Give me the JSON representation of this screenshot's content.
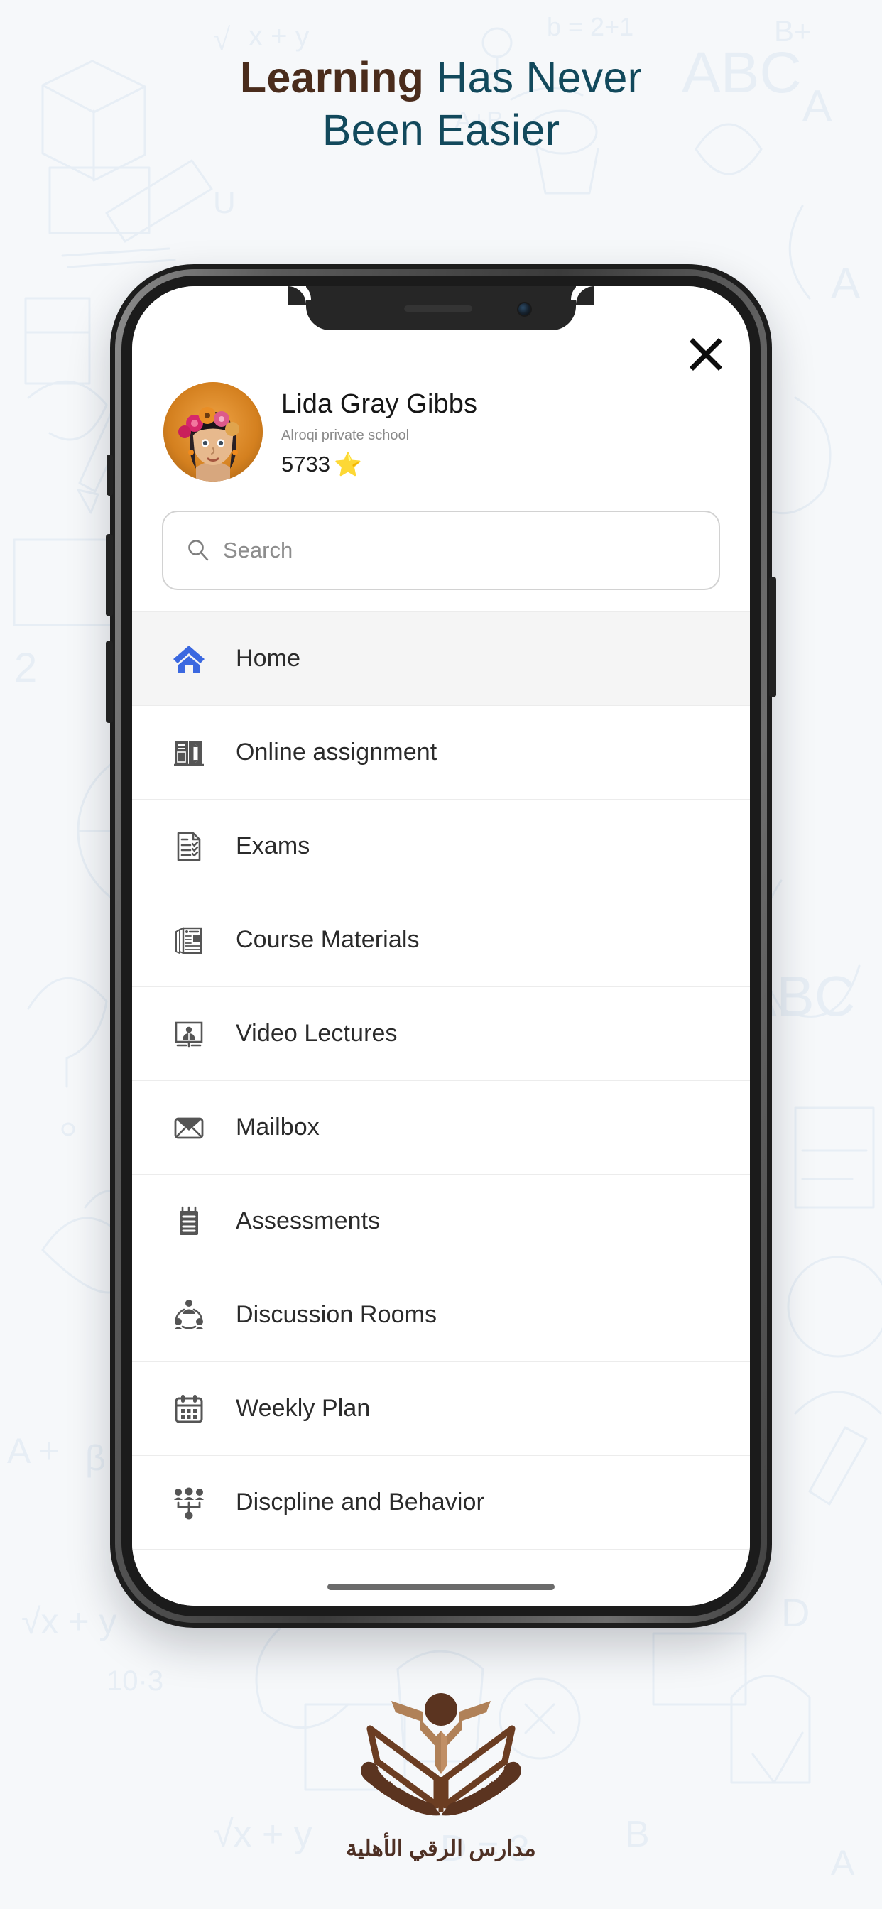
{
  "page": {
    "background_color": "#f6f8fa",
    "doodle_color": "#dbe6f2"
  },
  "headline": {
    "bold_part": "Learning",
    "light_part": " Has Never",
    "line2": "Been Easier",
    "bold_color": "#4a2c1c",
    "light_color": "#12495c"
  },
  "app": {
    "close_label": "close",
    "profile": {
      "name": "Lida Gray Gibbs",
      "school": "Alroqi private school",
      "points": "5733",
      "star": "⭐",
      "avatar_alt": "student-portrait"
    },
    "search": {
      "placeholder": "Search",
      "value": "",
      "icon": "search-icon"
    },
    "menu": [
      {
        "label": "Home",
        "icon": "home-icon",
        "active": true,
        "accent": "#3b68e0"
      },
      {
        "label": "Online assignment",
        "icon": "book-pencil-icon",
        "active": false,
        "accent": "#555555"
      },
      {
        "label": "Exams",
        "icon": "checklist-doc-icon",
        "active": false,
        "accent": "#555555"
      },
      {
        "label": "Course Materials",
        "icon": "newspaper-icon",
        "active": false,
        "accent": "#555555"
      },
      {
        "label": "Video Lectures",
        "icon": "presentation-icon",
        "active": false,
        "accent": "#555555"
      },
      {
        "label": "Mailbox",
        "icon": "envelope-icon",
        "active": false,
        "accent": "#555555"
      },
      {
        "label": "Assessments",
        "icon": "notepad-icon",
        "active": false,
        "accent": "#555555"
      },
      {
        "label": "Discussion Rooms",
        "icon": "group-circle-icon",
        "active": false,
        "accent": "#555555"
      },
      {
        "label": "Weekly Plan",
        "icon": "calendar-icon",
        "active": false,
        "accent": "#555555"
      },
      {
        "label": "Discpline and Behavior",
        "icon": "org-people-icon",
        "active": false,
        "accent": "#555555"
      }
    ]
  },
  "footer": {
    "logo_name": "alroqi-schools-logo",
    "arabic_text": "مدارس الرقي الأهلية",
    "logo_dark": "#5b3420",
    "logo_light": "#b08158"
  }
}
